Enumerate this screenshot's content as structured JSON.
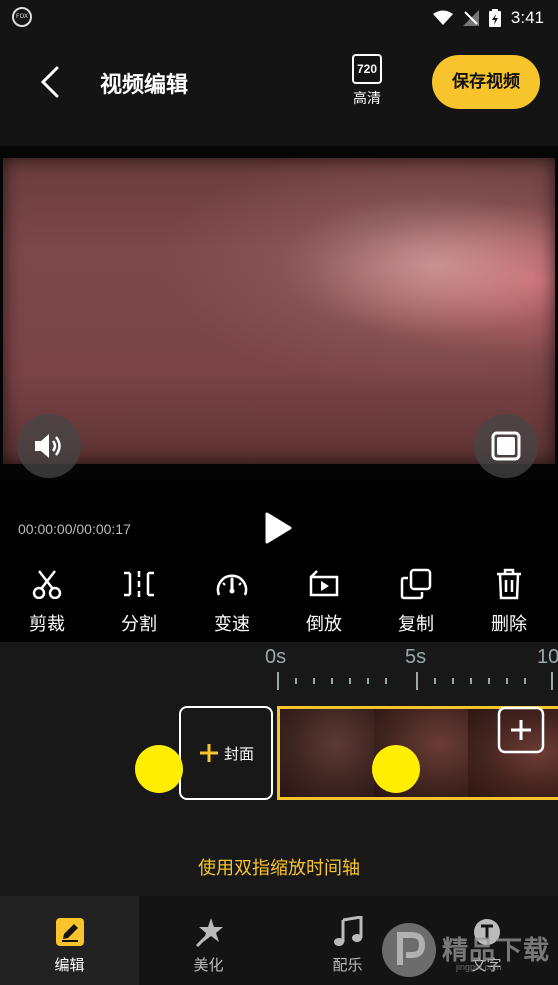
{
  "status_bar": {
    "time": "3:41",
    "logo_text": "FOX"
  },
  "header": {
    "title": "视频编辑",
    "quality_value": "720",
    "quality_label": "高清",
    "save_label": "保存视频"
  },
  "player": {
    "time_readout": "00:00:00/00:00:17"
  },
  "tools": [
    {
      "label": "剪裁",
      "icon": "scissors-icon"
    },
    {
      "label": "分割",
      "icon": "split-icon"
    },
    {
      "label": "变速",
      "icon": "speedometer-icon"
    },
    {
      "label": "倒放",
      "icon": "reverse-icon"
    },
    {
      "label": "复制",
      "icon": "copy-icon"
    },
    {
      "label": "删除",
      "icon": "trash-icon"
    }
  ],
  "timeline": {
    "ruler_labels": [
      "0s",
      "5s",
      "10"
    ],
    "cover_label": "封面",
    "hint": "使用双指缩放时间轴"
  },
  "nav": [
    {
      "label": "编辑",
      "icon": "edit-icon",
      "active": true
    },
    {
      "label": "美化",
      "icon": "magic-wand-icon",
      "active": false
    },
    {
      "label": "配乐",
      "icon": "music-note-icon",
      "active": false
    },
    {
      "label": "文字",
      "icon": "text-icon",
      "active": false
    }
  ],
  "watermark": {
    "text": "精品下载",
    "sub": "jingpin.com"
  },
  "colors": {
    "accent": "#f8c42c",
    "handle": "#ffee00",
    "background": "#000000",
    "panel": "#181818"
  }
}
